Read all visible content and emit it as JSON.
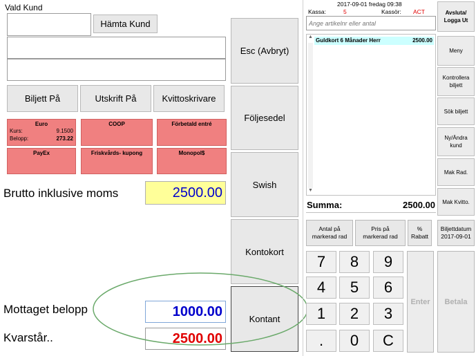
{
  "customer": {
    "label": "Vald Kund",
    "fetch_button": "Hämta Kund"
  },
  "toggles": [
    "Biljett På",
    "Utskrift På",
    "Kvittoskrivare"
  ],
  "payment_tiles": {
    "euro": {
      "title": "Euro",
      "rate_label": "Kurs:",
      "rate_value": "9.1500",
      "amount_label": "Belopp:",
      "amount_value": "273.22"
    },
    "coop": "COOP",
    "prepaid": "Förbetald entré",
    "payex": "PayEx",
    "voucher": "Friskvårds- kupong",
    "monopol": "Monopol$"
  },
  "gross": {
    "label": "Brutto inklusive moms",
    "value": "2500.00"
  },
  "received": {
    "label": "Mottaget belopp",
    "value": "1000.00"
  },
  "remaining": {
    "label": "Kvarstår..",
    "value": "2500.00"
  },
  "actions": [
    "Esc (Avbryt)",
    "Följesedel",
    "Swish",
    "Kontokort",
    "Kontant"
  ],
  "header": {
    "datetime": "2017-09-01 fredag 09:38",
    "register_label": "Kassa:",
    "register_value": "5",
    "cashier_label": "Kassör:",
    "cashier_value": "ACT"
  },
  "article_input": {
    "placeholder": "Ange artikelnr eller antal"
  },
  "cart": {
    "items": [
      {
        "name": "Guldkort 6 Månader Herr",
        "price": "2500.00"
      }
    ]
  },
  "total": {
    "label": "Summa:",
    "value": "2500.00"
  },
  "qty_buttons": [
    "Antal på markerad rad",
    "Pris på markerad rad",
    "% Rabatt",
    "Biljettdatum 2017-09-01"
  ],
  "keypad": [
    "7",
    "8",
    "9",
    "4",
    "5",
    "6",
    "1",
    "2",
    "3",
    ".",
    "0",
    "C"
  ],
  "enter_label": "Enter",
  "pay_label": "Betala",
  "side_menu": [
    "Avsluta/ Logga Ut",
    "Meny",
    "Kontrollera biljett",
    "Sök biljett",
    "Ny/Ändra kund",
    "Mak Rad.",
    "Mak Kvitto."
  ],
  "colors": {
    "yellow": "#ffff99",
    "blue_value": "#0000cc",
    "red_value": "#e00000",
    "pink_tile": "#f08080",
    "cart_highlight": "#ccffff",
    "ellipse": "#6aa96a"
  }
}
